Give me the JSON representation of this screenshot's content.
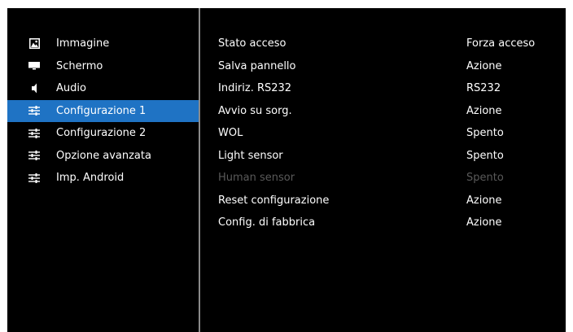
{
  "sidebar": {
    "items": [
      {
        "label": "Immagine",
        "icon": "image-icon",
        "selected": false
      },
      {
        "label": "Schermo",
        "icon": "screen-icon",
        "selected": false
      },
      {
        "label": "Audio",
        "icon": "speaker-icon",
        "selected": false
      },
      {
        "label": "Configurazione 1",
        "icon": "sliders-icon",
        "selected": true
      },
      {
        "label": "Configurazione 2",
        "icon": "sliders-icon",
        "selected": false
      },
      {
        "label": "Opzione avanzata",
        "icon": "sliders-icon",
        "selected": false
      },
      {
        "label": "Imp. Android",
        "icon": "sliders-icon",
        "selected": false
      }
    ]
  },
  "settings": {
    "rows": [
      {
        "label": "Stato acceso",
        "value": "Forza acceso",
        "enabled": true
      },
      {
        "label": "Salva pannello",
        "value": "Azione",
        "enabled": true
      },
      {
        "label": "Indiriz. RS232",
        "value": "RS232",
        "enabled": true
      },
      {
        "label": "Avvio su sorg.",
        "value": "Azione",
        "enabled": true
      },
      {
        "label": "WOL",
        "value": "Spento",
        "enabled": true
      },
      {
        "label": "Light sensor",
        "value": "Spento",
        "enabled": true
      },
      {
        "label": "Human sensor",
        "value": "Spento",
        "enabled": false
      },
      {
        "label": "Reset configurazione",
        "value": "Azione",
        "enabled": true
      },
      {
        "label": "Config. di fabbrica",
        "value": "Azione",
        "enabled": true
      }
    ]
  },
  "colors": {
    "background": "#000000",
    "selected": "#1f73c4",
    "text": "#ffffff",
    "disabled_text": "#5a5a5a",
    "divider": "#8a8a8a"
  }
}
